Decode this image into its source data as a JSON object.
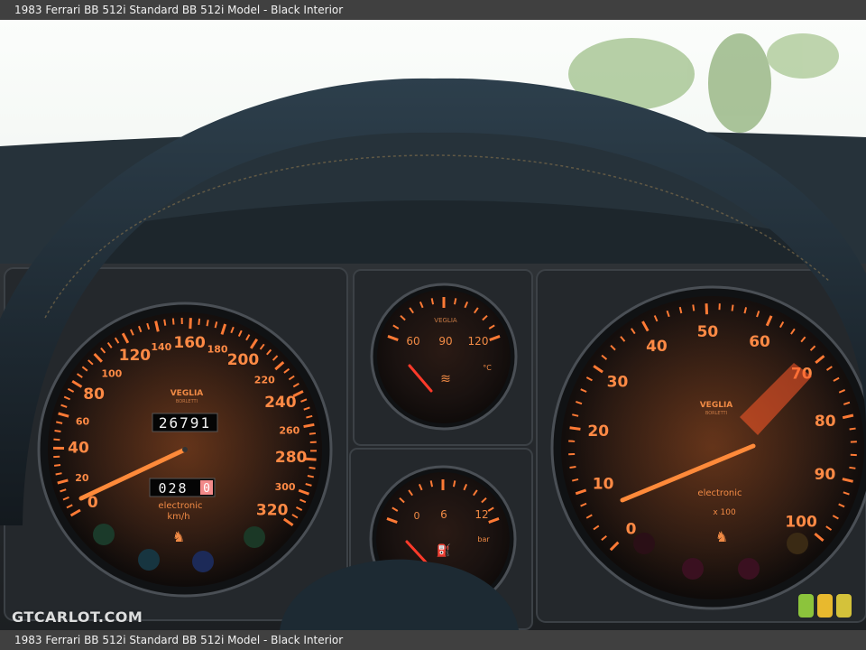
{
  "caption": "1983 Ferrari BB 512i Standard BB 512i Model - Black Interior",
  "watermark": "GTCARLOT.COM",
  "badge_colors": [
    "#8cc43c",
    "#e8b92e",
    "#d4c23a"
  ],
  "speedometer": {
    "numerals": [
      "0",
      "20",
      "40",
      "60",
      "80",
      "100",
      "120",
      "140",
      "160",
      "180",
      "200",
      "220",
      "240",
      "260",
      "280",
      "300",
      "320"
    ],
    "brand": "VEGLIA",
    "sub_brand": "BORLETTI",
    "odometer": "26791",
    "trip": "028",
    "trip_digit": "0",
    "label_electronic": "electronic",
    "unit": "km/h"
  },
  "temp_gauge": {
    "brand": "VEGLIA",
    "numerals": [
      "60",
      "90",
      "120"
    ],
    "unit": "°C"
  },
  "oil_gauge": {
    "numerals": [
      "0",
      "6",
      "12"
    ],
    "unit": "bar"
  },
  "tachometer": {
    "numerals": [
      "0",
      "10",
      "20",
      "30",
      "40",
      "50",
      "60",
      "70",
      "80",
      "90",
      "100"
    ],
    "brand": "VEGLIA",
    "sub_brand": "BORLETTI",
    "label_electronic": "electronic",
    "multiplier": "x 100"
  }
}
